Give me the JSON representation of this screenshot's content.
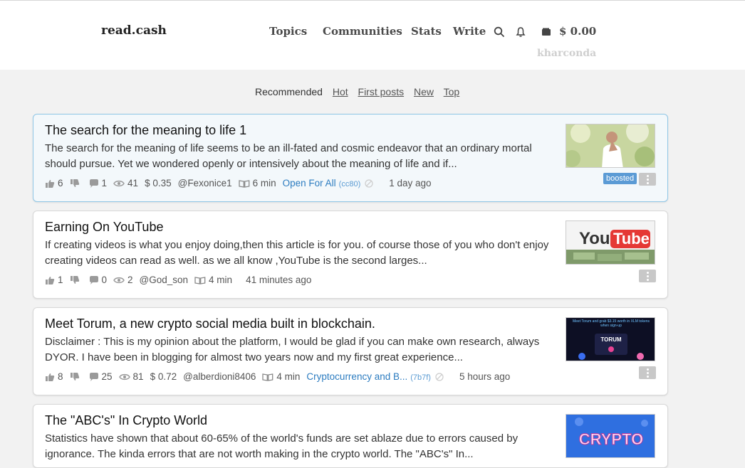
{
  "site": {
    "logo": "read.cash"
  },
  "nav": {
    "topics": "Topics",
    "communities": "Communities",
    "stats": "Stats",
    "write": "Write",
    "balance": "$ 0.00",
    "username": "kharconda"
  },
  "tabs": {
    "recommended": "Recommended",
    "hot": "Hot",
    "first_posts": "First posts",
    "new": "New",
    "top": "Top"
  },
  "articles": [
    {
      "title": "The search for the meaning to life 1",
      "excerpt": "The search for the meaning of life seems to be an ill-fated and cosmic endeavor that an ordinary mortal should pursue. Yet we wondered openly or intensively about the meaning of life and if...",
      "upvotes": "6",
      "comments": "1",
      "views": "41",
      "earnings": "$ 0.35",
      "author": "@Fexonice1",
      "read_time": "6 min",
      "community": "Open For All",
      "community_code": "(cc80)",
      "time": "1 day ago",
      "badge": "boosted",
      "thumb": "man-thinking"
    },
    {
      "title": "Earning On YouTube",
      "excerpt": "If creating videos is what you enjoy doing,then this article is for you. of course those of you who don't enjoy creating videos can read as well. as we all know ,YouTube is the second larges...",
      "upvotes": "1",
      "comments": "0",
      "views": "2",
      "author": "@God_son",
      "read_time": "4 min",
      "time": "41 minutes ago",
      "thumb": "youtube-money",
      "thumb_text_a": "You",
      "thumb_text_b": "Tube"
    },
    {
      "title": "Meet Torum, a new crypto social media built in blockchain.",
      "excerpt": "Disclaimer : This is my opinion about the platform, I would be glad if you can make own research, always DYOR. I have been in blogging for almost two years now and my first great experience...",
      "upvotes": "8",
      "comments": "25",
      "views": "81",
      "earnings": "$ 0.72",
      "author": "@alberdioni8406",
      "read_time": "4 min",
      "community": "Cryptocurrency and B...",
      "community_code": "(7b7f)",
      "time": "5 hours ago",
      "thumb": "torum",
      "thumb_text_a": "Meet Torum and grab $3.15 worth in XLM tokens when sign-up",
      "thumb_text_b": "TORUM"
    },
    {
      "title": "The \"ABC's\" In Crypto World",
      "excerpt": "Statistics have shown that about 60-65% of the world's funds are set ablaze due to errors caused by ignorance. The kinda errors that are not worth making in the crypto world. The \"ABC's\" In...",
      "thumb": "crypto",
      "thumb_text_a": "CRYPTO"
    }
  ]
}
